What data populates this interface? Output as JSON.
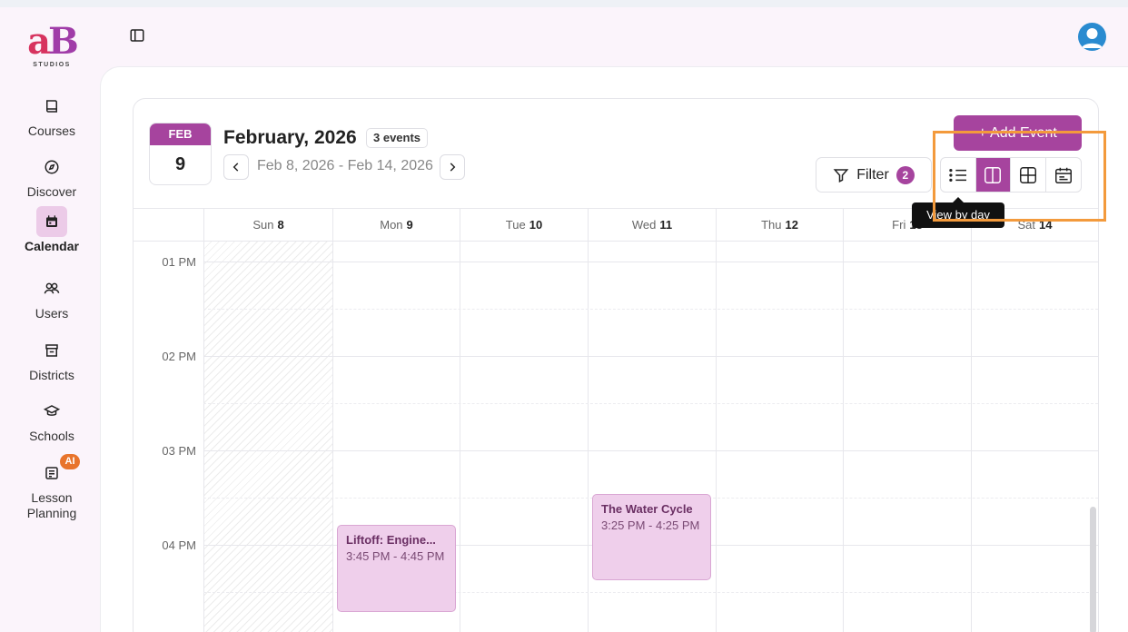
{
  "logo": {
    "text": "aB",
    "subtitle": "STUDIOS"
  },
  "sidebar": {
    "items": [
      {
        "label": "Courses",
        "icon": "book-icon"
      },
      {
        "label": "Discover",
        "icon": "compass-icon"
      },
      {
        "label": "Calendar",
        "icon": "calendar-icon",
        "active": true
      },
      {
        "label": "Users",
        "icon": "users-icon"
      },
      {
        "label": "Districts",
        "icon": "store-icon"
      },
      {
        "label": "Schools",
        "icon": "graduation-cap-icon"
      },
      {
        "label": "Lesson\nPlanning",
        "icon": "notepad-icon",
        "badge": "AI"
      }
    ]
  },
  "header": {
    "date_badge_month": "FEB",
    "date_badge_day": "9",
    "title": "February, 2026",
    "events_count": "3 events",
    "range": "Feb 8, 2026 - Feb 14, 2026"
  },
  "toolbar": {
    "add_event": "+ Add Event",
    "filter_label": "Filter",
    "filter_count": "2",
    "tooltip": "View by day"
  },
  "days": [
    {
      "name": "Sun",
      "num": "8"
    },
    {
      "name": "Mon",
      "num": "9"
    },
    {
      "name": "Tue",
      "num": "10"
    },
    {
      "name": "Wed",
      "num": "11"
    },
    {
      "name": "Thu",
      "num": "12"
    },
    {
      "name": "Fri",
      "num": "13"
    },
    {
      "name": "Sat",
      "num": "14"
    }
  ],
  "times": [
    "01 PM",
    "02 PM",
    "03 PM",
    "04 PM"
  ],
  "events": [
    {
      "title": "Liftoff: Engine...",
      "time": "3:45 PM - 4:45 PM",
      "day": "Mon"
    },
    {
      "title": "The Water Cycle",
      "time": "3:25 PM - 4:25 PM",
      "day": "Wed"
    }
  ],
  "colors": {
    "accent": "#a6449e",
    "event_bg": "#efcfeb",
    "highlight": "#f39a3c"
  }
}
